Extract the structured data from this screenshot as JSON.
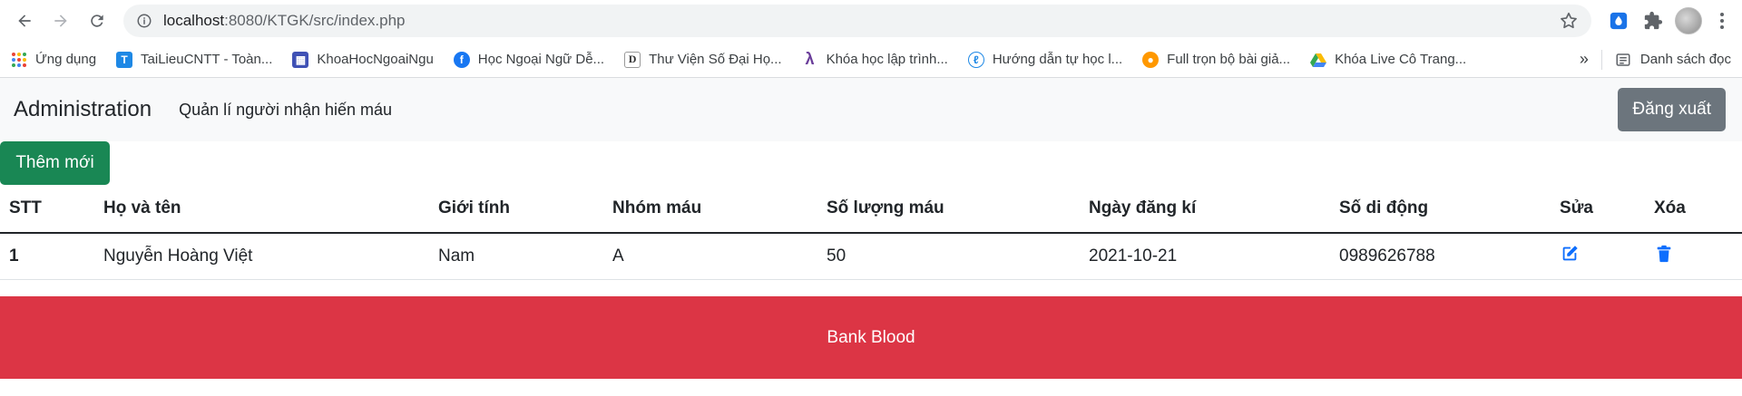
{
  "browser": {
    "url_host": "localhost",
    "url_path": ":8080/KTGK/src/index.php",
    "bookmarks": [
      {
        "label": "Ứng dụng"
      },
      {
        "label": "TaiLieuCNTT - Toàn..."
      },
      {
        "label": "KhoaHocNgoaiNgu"
      },
      {
        "label": "Học Ngoại Ngữ Dễ..."
      },
      {
        "label": "Thư Viện Số Đại Họ..."
      },
      {
        "label": "Khóa học lập trình..."
      },
      {
        "label": "Hướng dẫn tự học l..."
      },
      {
        "label": "Full trọn bộ bài giả..."
      },
      {
        "label": "Khóa Live Cô Trang..."
      }
    ],
    "more": "»",
    "reading_list": "Danh sách đọc"
  },
  "navbar": {
    "brand": "Administration",
    "link": "Quản lí người nhận hiến máu",
    "logout": "Đăng xuất"
  },
  "add_button": "Thêm mới",
  "table": {
    "headers": [
      "STT",
      "Họ và tên",
      "Giới tính",
      "Nhóm máu",
      "Số lượng máu",
      "Ngày đăng kí",
      "Số di động",
      "Sửa",
      "Xóa"
    ],
    "rows": [
      {
        "stt": "1",
        "name": "Nguyễn Hoàng Việt",
        "gender": "Nam",
        "blood_group": "A",
        "amount": "50",
        "date": "2021-10-21",
        "phone": "0989626788"
      }
    ]
  },
  "footer": "Bank Blood",
  "colors": {
    "success": "#198754",
    "secondary": "#6c757d",
    "danger": "#dc3545",
    "primary": "#0d6efd"
  }
}
